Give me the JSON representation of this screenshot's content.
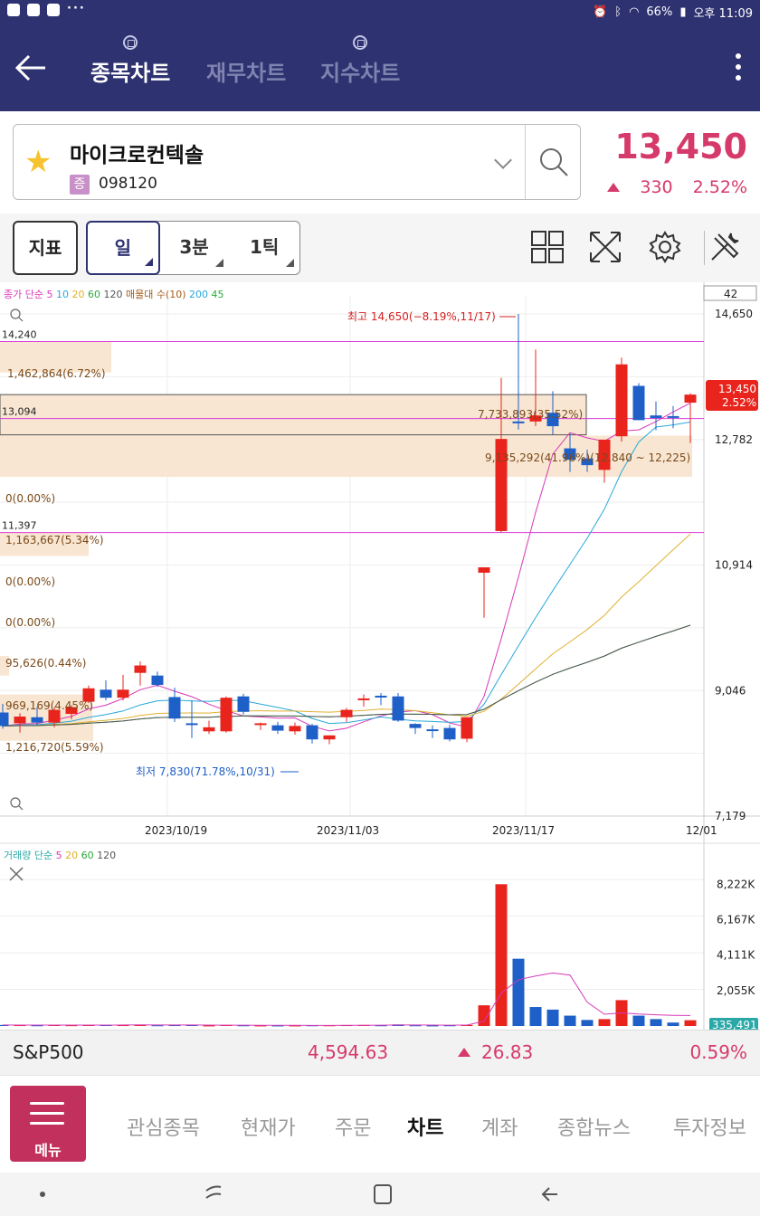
{
  "status_bar": {
    "battery": "66%",
    "time": "오후 11:09"
  },
  "app_bar": {
    "tabs": [
      {
        "label": "종목차트",
        "active": true
      },
      {
        "label": "재무차트",
        "active": false
      },
      {
        "label": "지수차트",
        "active": false
      }
    ]
  },
  "stock": {
    "name": "마이크로컨텍솔",
    "market_badge": "증",
    "code": "098120",
    "price": "13,450",
    "change": "330",
    "change_pct": "2.52%"
  },
  "toolbar": {
    "indicator_label": "지표",
    "periods": [
      "일",
      "3분",
      "1틱"
    ],
    "selected_period": "일",
    "icons": [
      "grid-layout-icon",
      "fullscreen-icon",
      "settings-gear-icon",
      "tools-icon"
    ]
  },
  "chart_data": [
    {
      "type": "candlestick",
      "title": "",
      "legend": {
        "label": "종가 단순",
        "ma_periods": [
          "5",
          "10",
          "20",
          "60",
          "120"
        ],
        "ma_colors": [
          "#d63ab8",
          "#2aa8d8",
          "#e0b030",
          "#2aaa3a",
          "#555555"
        ],
        "extra": "매물대 수(10)",
        "extra_values": [
          "200",
          "45"
        ]
      },
      "count_box": "42",
      "y_ticks": [
        "14,650",
        "12,782",
        "10,914",
        "9,046",
        "7,179"
      ],
      "ylim": [
        7179,
        14650
      ],
      "x_ticks": [
        "2023/10/19",
        "2023/11/03",
        "2023/11/17",
        "12/01"
      ],
      "current_price_label": "13,450",
      "current_pct_label": "2.52%",
      "max_annotation": "최고 14,650(−8.19%,11/17)",
      "min_annotation": "최저 7,830(71.78%,10/31)",
      "left_labels": [
        "14,240",
        "13,094",
        "11,397"
      ],
      "horizontal_lines": [
        14240,
        13094,
        11397
      ],
      "volume_profile_labels": [
        "1,462,864(6.72%)",
        "7,733,893(35.52%)",
        "9,135,292(41.96%)(12,840 ~ 12,225)",
        "0(0.00%)",
        "1,163,667(5.34%)",
        "0(0.00%)",
        "0(0.00%)",
        "95,626(0.44%)",
        "969,169(4.45%)",
        "1,216,720(5.59%)"
      ],
      "candles": [
        {
          "date": "2023/10/16",
          "o": 8720,
          "h": 8850,
          "l": 8480,
          "c": 8520
        },
        {
          "date": "2023/10/17",
          "o": 8560,
          "h": 8710,
          "l": 8420,
          "c": 8660
        },
        {
          "date": "2023/10/18",
          "o": 8650,
          "h": 8800,
          "l": 8530,
          "c": 8570
        },
        {
          "date": "2023/10/19",
          "o": 8570,
          "h": 8800,
          "l": 8500,
          "c": 8760
        },
        {
          "date": "2023/10/20",
          "o": 8700,
          "h": 8830,
          "l": 8620,
          "c": 8800
        },
        {
          "date": "2023/10/23",
          "o": 8880,
          "h": 9120,
          "l": 8860,
          "c": 9080
        },
        {
          "date": "2023/10/24",
          "o": 9060,
          "h": 9200,
          "l": 8900,
          "c": 8940
        },
        {
          "date": "2023/10/25",
          "o": 8940,
          "h": 9280,
          "l": 8900,
          "c": 9060
        },
        {
          "date": "2023/10/26",
          "o": 9310,
          "h": 9480,
          "l": 9120,
          "c": 9420
        },
        {
          "date": "2023/10/27",
          "o": 9270,
          "h": 9330,
          "l": 9100,
          "c": 9130
        },
        {
          "date": "2023/10/30",
          "o": 8950,
          "h": 9090,
          "l": 8580,
          "c": 8630
        },
        {
          "date": "2023/10/31",
          "o": 8560,
          "h": 8900,
          "l": 8340,
          "c": 8540
        },
        {
          "date": "2023/11/01",
          "o": 8440,
          "h": 8600,
          "l": 8400,
          "c": 8500
        },
        {
          "date": "2023/11/02",
          "o": 8440,
          "h": 8960,
          "l": 8420,
          "c": 8940
        },
        {
          "date": "2023/11/03",
          "o": 8960,
          "h": 9000,
          "l": 8690,
          "c": 8730
        },
        {
          "date": "2023/11/06",
          "o": 8550,
          "h": 8570,
          "l": 8460,
          "c": 8560
        },
        {
          "date": "2023/11/07",
          "o": 8530,
          "h": 8580,
          "l": 8400,
          "c": 8450
        },
        {
          "date": "2023/11/08",
          "o": 8440,
          "h": 8570,
          "l": 8390,
          "c": 8520
        },
        {
          "date": "2023/11/09",
          "o": 8530,
          "h": 8550,
          "l": 8260,
          "c": 8320
        },
        {
          "date": "2023/11/10",
          "o": 8320,
          "h": 8380,
          "l": 8250,
          "c": 8380
        },
        {
          "date": "2023/11/13",
          "o": 8650,
          "h": 8790,
          "l": 8580,
          "c": 8760
        },
        {
          "date": "2023/11/14",
          "o": 8920,
          "h": 8990,
          "l": 8810,
          "c": 8930
        },
        {
          "date": "2023/11/15",
          "o": 8970,
          "h": 9010,
          "l": 8830,
          "c": 8960
        },
        {
          "date": "2023/11/16",
          "o": 8960,
          "h": 9010,
          "l": 8580,
          "c": 8600
        },
        {
          "date": "2023/11/17",
          "o": 8550,
          "h": 8560,
          "l": 8400,
          "c": 8490
        },
        {
          "date": "2023/11/20",
          "o": 8470,
          "h": 8530,
          "l": 8340,
          "c": 8460
        },
        {
          "date": "2023/11/21",
          "o": 8490,
          "h": 8540,
          "l": 8290,
          "c": 8320
        },
        {
          "date": "2023/11/22",
          "o": 8330,
          "h": 8630,
          "l": 8280,
          "c": 8650
        },
        {
          "date": "2023/11/23",
          "o": 10800,
          "h": 10820,
          "l": 10130,
          "c": 10880
        },
        {
          "date": "2023/11/24",
          "o": 11420,
          "h": 13700,
          "l": 11400,
          "c": 12790
        },
        {
          "date": "2023/11/27",
          "o": 13050,
          "h": 14650,
          "l": 12930,
          "c": 13030
        },
        {
          "date": "2023/11/28",
          "o": 13050,
          "h": 14120,
          "l": 12980,
          "c": 13140
        },
        {
          "date": "2023/11/29",
          "o": 13180,
          "h": 13500,
          "l": 12850,
          "c": 12980
        },
        {
          "date": "2023/11/30",
          "o": 12650,
          "h": 12870,
          "l": 12300,
          "c": 12480
        },
        {
          "date": "2023/12/01",
          "o": 12500,
          "h": 12630,
          "l": 12300,
          "c": 12400
        },
        {
          "date": "2023/12/04",
          "o": 12330,
          "h": 12740,
          "l": 12140,
          "c": 12780
        },
        {
          "date": "2023/12/05",
          "o": 12830,
          "h": 14000,
          "l": 12750,
          "c": 13900
        },
        {
          "date": "2023/12/06",
          "o": 13580,
          "h": 13620,
          "l": 13070,
          "c": 13070
        },
        {
          "date": "2023/12/07",
          "o": 13140,
          "h": 13350,
          "l": 12920,
          "c": 13100
        },
        {
          "date": "2023/12/08",
          "o": 13130,
          "h": 13280,
          "l": 12950,
          "c": 13110
        },
        {
          "date": "2023/12/11",
          "o": 13330,
          "h": 13470,
          "l": 12730,
          "c": 13450
        }
      ]
    },
    {
      "type": "bar",
      "title": "",
      "legend": {
        "label": "거래량 단순",
        "ma_periods": [
          "5",
          "20",
          "60",
          "120"
        ],
        "ma_colors": [
          "#d63ab8",
          "#e0b030",
          "#2aaa3a",
          "#555555"
        ]
      },
      "y_ticks": [
        "8,222K",
        "6,167K",
        "4,111K",
        "2,055K"
      ],
      "ylim": [
        0,
        8500
      ],
      "unit": "K",
      "last_volume_label": "335,491",
      "volumes": [
        {
          "v": 60,
          "up": false
        },
        {
          "v": 50,
          "up": true
        },
        {
          "v": 40,
          "up": false
        },
        {
          "v": 55,
          "up": true
        },
        {
          "v": 45,
          "up": true
        },
        {
          "v": 70,
          "up": true
        },
        {
          "v": 60,
          "up": false
        },
        {
          "v": 50,
          "up": true
        },
        {
          "v": 80,
          "up": true
        },
        {
          "v": 40,
          "up": false
        },
        {
          "v": 50,
          "up": false
        },
        {
          "v": 60,
          "up": false
        },
        {
          "v": 30,
          "up": true
        },
        {
          "v": 60,
          "up": true
        },
        {
          "v": 40,
          "up": false
        },
        {
          "v": 30,
          "up": true
        },
        {
          "v": 30,
          "up": false
        },
        {
          "v": 30,
          "up": true
        },
        {
          "v": 40,
          "up": false
        },
        {
          "v": 40,
          "up": true
        },
        {
          "v": 50,
          "up": true
        },
        {
          "v": 60,
          "up": true
        },
        {
          "v": 40,
          "up": false
        },
        {
          "v": 90,
          "up": false
        },
        {
          "v": 40,
          "up": false
        },
        {
          "v": 30,
          "up": false
        },
        {
          "v": 40,
          "up": false
        },
        {
          "v": 60,
          "up": true
        },
        {
          "v": 1200,
          "up": true
        },
        {
          "v": 8222,
          "up": true
        },
        {
          "v": 3900,
          "up": false
        },
        {
          "v": 1100,
          "up": false
        },
        {
          "v": 950,
          "up": false
        },
        {
          "v": 600,
          "up": false
        },
        {
          "v": 350,
          "up": false
        },
        {
          "v": 400,
          "up": true
        },
        {
          "v": 1500,
          "up": true
        },
        {
          "v": 600,
          "up": false
        },
        {
          "v": 400,
          "up": false
        },
        {
          "v": 200,
          "up": false
        },
        {
          "v": 335,
          "up": true
        }
      ]
    }
  ],
  "index_ticker": {
    "name": "S&P500",
    "value": "4,594.63",
    "change": "26.83",
    "change_pct": "0.59%"
  },
  "bottom_nav": {
    "menu_label": "메뉴",
    "items": [
      {
        "label": "관심종목",
        "active": false
      },
      {
        "label": "현재가",
        "active": false
      },
      {
        "label": "주문",
        "active": false
      },
      {
        "label": "차트",
        "active": true
      },
      {
        "label": "계좌",
        "active": false
      },
      {
        "label": "종합뉴스",
        "active": false
      },
      {
        "label": "투자정보",
        "active": false
      }
    ]
  },
  "colors": {
    "brand": "#2e3270",
    "up": "#e8241c",
    "down": "#1e5fc8",
    "accent": "#d63a6a",
    "menu": "#c2305e"
  }
}
